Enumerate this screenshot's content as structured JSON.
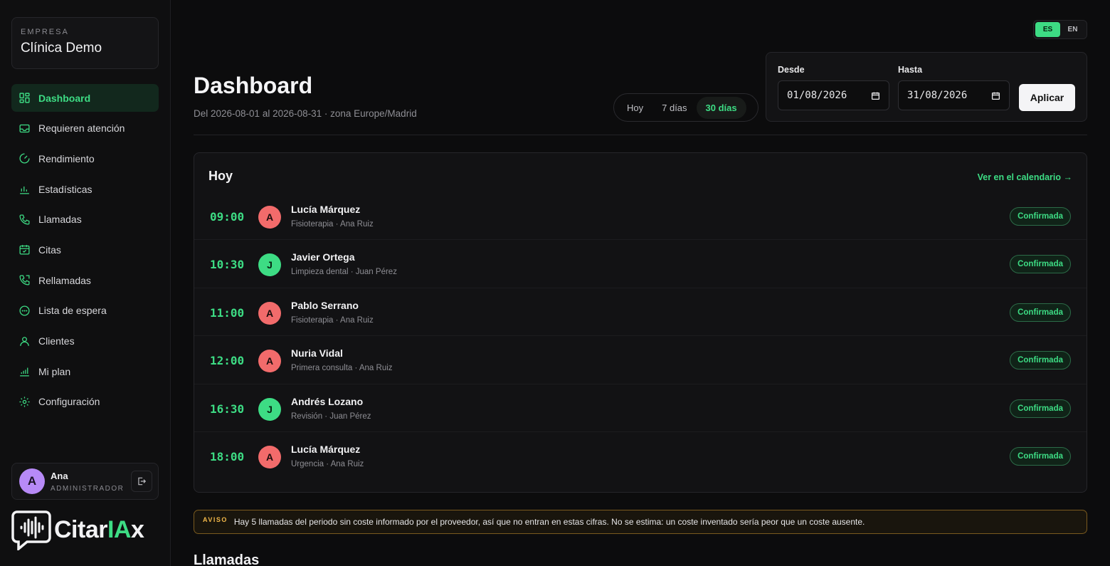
{
  "sidebar": {
    "company_label": "EMPRESA",
    "company_name": "Clínica Demo",
    "items": [
      {
        "label": "Dashboard",
        "icon": "grid-icon",
        "active": true
      },
      {
        "label": "Requieren atención",
        "icon": "inbox-icon"
      },
      {
        "label": "Rendimiento",
        "icon": "gauge-icon"
      },
      {
        "label": "Estadísticas",
        "icon": "bar-chart-icon"
      },
      {
        "label": "Llamadas",
        "icon": "phone-icon"
      },
      {
        "label": "Citas",
        "icon": "calendar-icon"
      },
      {
        "label": "Rellamadas",
        "icon": "phone-callback-icon"
      },
      {
        "label": "Lista de espera",
        "icon": "clock-dots-icon"
      },
      {
        "label": "Clientes",
        "icon": "user-icon"
      },
      {
        "label": "Mi plan",
        "icon": "plan-chart-icon"
      },
      {
        "label": "Configuración",
        "icon": "gear-icon"
      }
    ],
    "user": {
      "initial": "A",
      "name": "Ana",
      "role": "ADMINISTRADOR"
    },
    "brand": {
      "part1": "Citar",
      "part2": "IA",
      "part3": "x"
    }
  },
  "lang": {
    "es": "ES",
    "en": "EN",
    "active": "ES"
  },
  "header": {
    "title": "Dashboard",
    "subtitle": "Del 2026-08-01 al 2026-08-31 · zona Europe/Madrid"
  },
  "ranges": {
    "today": "Hoy",
    "week": "7 días",
    "month": "30 días",
    "active": "30 días"
  },
  "filter": {
    "from_label": "Desde",
    "from_value": "01/08/2026",
    "to_label": "Hasta",
    "to_value": "31/08/2026",
    "apply": "Aplicar"
  },
  "today": {
    "title": "Hoy",
    "link": "Ver en el calendario →",
    "appointments": [
      {
        "time": "09:00",
        "initial": "A",
        "color": "red",
        "name": "Lucía Márquez",
        "detail": "Fisioterapia · Ana Ruiz",
        "status": "Confirmada"
      },
      {
        "time": "10:30",
        "initial": "J",
        "color": "green",
        "name": "Javier Ortega",
        "detail": "Limpieza dental · Juan Pérez",
        "status": "Confirmada"
      },
      {
        "time": "11:00",
        "initial": "A",
        "color": "red",
        "name": "Pablo Serrano",
        "detail": "Fisioterapia · Ana Ruiz",
        "status": "Confirmada"
      },
      {
        "time": "12:00",
        "initial": "A",
        "color": "red",
        "name": "Nuria Vidal",
        "detail": "Primera consulta · Ana Ruiz",
        "status": "Confirmada"
      },
      {
        "time": "16:30",
        "initial": "J",
        "color": "green",
        "name": "Andrés Lozano",
        "detail": "Revisión · Juan Pérez",
        "status": "Confirmada"
      },
      {
        "time": "18:00",
        "initial": "A",
        "color": "red",
        "name": "Lucía Márquez",
        "detail": "Urgencia · Ana Ruiz",
        "status": "Confirmada"
      }
    ]
  },
  "notice": {
    "tag": "AVISO",
    "text": "Hay 5 llamadas del periodo sin coste informado por el proveedor, así que no entran en estas cifras. No se estima: un coste inventado sería peor que un coste ausente."
  },
  "calls_section": {
    "title": "Llamadas"
  },
  "colors": {
    "accent": "#3ddc84",
    "red_avatar": "#f26b6b",
    "warning": "#f2b84a",
    "background": "#0c0c0d"
  }
}
